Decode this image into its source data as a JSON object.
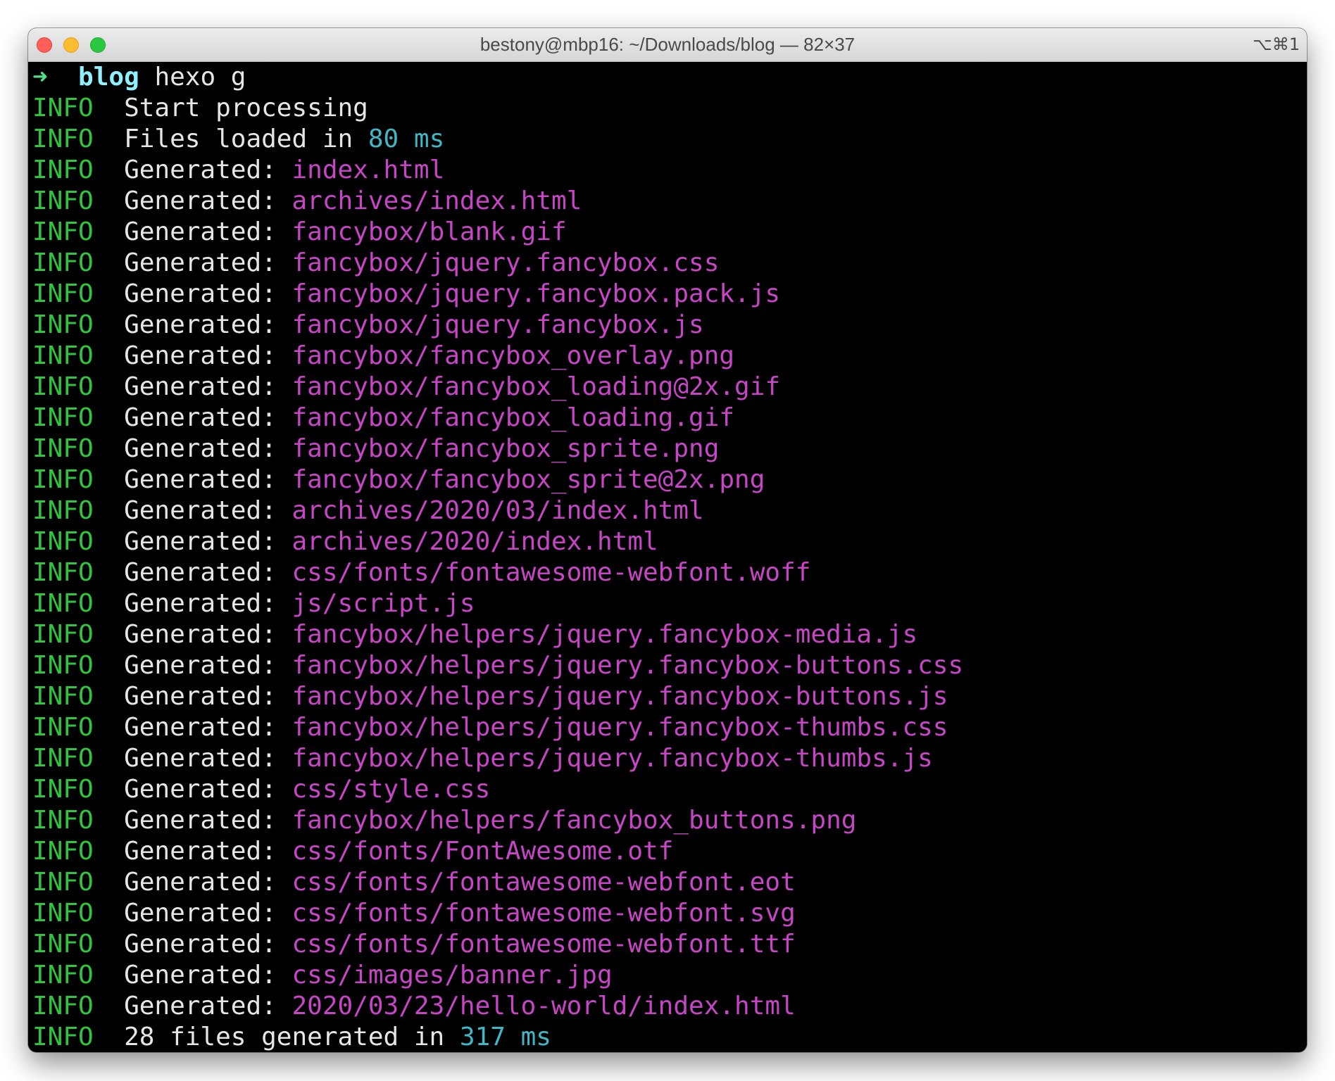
{
  "window": {
    "title": "bestony@mbp16: ~/Downloads/blog — 82×37",
    "shortcut": "⌥⌘1"
  },
  "colors": {
    "background": "#000000",
    "info": "#2fc53e",
    "path": "#c646c6",
    "number": "#41b6c4",
    "prompt_dir": "#8ff0ff",
    "prompt_arrow": "#4fe08a"
  },
  "prompt": {
    "arrow": "➜",
    "dir": "blog",
    "command": "hexo g"
  },
  "log": {
    "level": "INFO",
    "start": "Start processing",
    "loaded_prefix": "Files loaded in",
    "loaded_value": "80",
    "loaded_unit": "ms",
    "generated_label": "Generated:",
    "generated": [
      "index.html",
      "archives/index.html",
      "fancybox/blank.gif",
      "fancybox/jquery.fancybox.css",
      "fancybox/jquery.fancybox.pack.js",
      "fancybox/jquery.fancybox.js",
      "fancybox/fancybox_overlay.png",
      "fancybox/fancybox_loading@2x.gif",
      "fancybox/fancybox_loading.gif",
      "fancybox/fancybox_sprite.png",
      "fancybox/fancybox_sprite@2x.png",
      "archives/2020/03/index.html",
      "archives/2020/index.html",
      "css/fonts/fontawesome-webfont.woff",
      "js/script.js",
      "fancybox/helpers/jquery.fancybox-media.js",
      "fancybox/helpers/jquery.fancybox-buttons.css",
      "fancybox/helpers/jquery.fancybox-buttons.js",
      "fancybox/helpers/jquery.fancybox-thumbs.css",
      "fancybox/helpers/jquery.fancybox-thumbs.js",
      "css/style.css",
      "fancybox/helpers/fancybox_buttons.png",
      "css/fonts/FontAwesome.otf",
      "css/fonts/fontawesome-webfont.eot",
      "css/fonts/fontawesome-webfont.svg",
      "css/fonts/fontawesome-webfont.ttf",
      "css/images/banner.jpg",
      "2020/03/23/hello-world/index.html"
    ],
    "summary_prefix": "28 files generated in",
    "summary_value": "317",
    "summary_unit": "ms"
  }
}
